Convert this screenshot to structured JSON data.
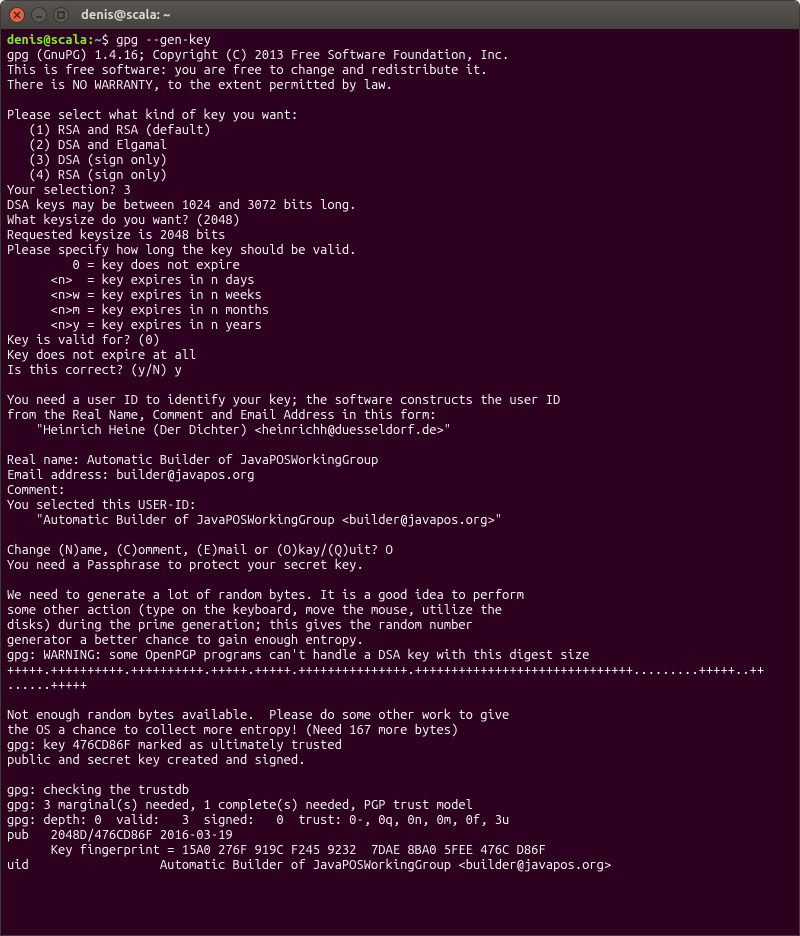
{
  "window": {
    "title": "denis@scala: ~",
    "close_icon": "close",
    "minimize_icon": "minimize",
    "maximize_icon": "maximize"
  },
  "prompt": {
    "userhost": "denis@scala",
    "path": "~",
    "command": "gpg --gen-key"
  },
  "lines": {
    "l1": "gpg (GnuPG) 1.4.16; Copyright (C) 2013 Free Software Foundation, Inc.",
    "l2": "This is free software: you are free to change and redistribute it.",
    "l3": "There is NO WARRANTY, to the extent permitted by law.",
    "l5": "Please select what kind of key you want:",
    "l6": "   (1) RSA and RSA (default)",
    "l7": "   (2) DSA and Elgamal",
    "l8": "   (3) DSA (sign only)",
    "l9": "   (4) RSA (sign only)",
    "l10": "Your selection? 3",
    "l11": "DSA keys may be between 1024 and 3072 bits long.",
    "l12": "What keysize do you want? (2048)",
    "l13": "Requested keysize is 2048 bits",
    "l14": "Please specify how long the key should be valid.",
    "l15": "         0 = key does not expire",
    "l16": "      <n>  = key expires in n days",
    "l17": "      <n>w = key expires in n weeks",
    "l18": "      <n>m = key expires in n months",
    "l19": "      <n>y = key expires in n years",
    "l20": "Key is valid for? (0)",
    "l21": "Key does not expire at all",
    "l22": "Is this correct? (y/N) y",
    "l24": "You need a user ID to identify your key; the software constructs the user ID",
    "l25": "from the Real Name, Comment and Email Address in this form:",
    "l26": "    \"Heinrich Heine (Der Dichter) <heinrichh@duesseldorf.de>\"",
    "l28": "Real name: Automatic Builder of JavaPOSWorkingGroup",
    "l29": "Email address: builder@javapos.org",
    "l30": "Comment:",
    "l31": "You selected this USER-ID:",
    "l32": "    \"Automatic Builder of JavaPOSWorkingGroup <builder@javapos.org>\"",
    "l34": "Change (N)ame, (C)omment, (E)mail or (O)kay/(Q)uit? O",
    "l35": "You need a Passphrase to protect your secret key.",
    "l37": "We need to generate a lot of random bytes. It is a good idea to perform",
    "l38": "some other action (type on the keyboard, move the mouse, utilize the",
    "l39": "disks) during the prime generation; this gives the random number",
    "l40": "generator a better chance to gain enough entropy.",
    "l41": "gpg: WARNING: some OpenPGP programs can't handle a DSA key with this digest size",
    "l42": "+++++.++++++++++.++++++++++.+++++.+++++.+++++++++++++++.++++++++++++++++++++++++++++++.........+++++..++",
    "l43": "......+++++",
    "l45": "Not enough random bytes available.  Please do some other work to give",
    "l46": "the OS a chance to collect more entropy! (Need 167 more bytes)",
    "l47": "gpg: key 476CD86F marked as ultimately trusted",
    "l48": "public and secret key created and signed.",
    "l50": "gpg: checking the trustdb",
    "l51": "gpg: 3 marginal(s) needed, 1 complete(s) needed, PGP trust model",
    "l52": "gpg: depth: 0  valid:   3  signed:   0  trust: 0-, 0q, 0n, 0m, 0f, 3u",
    "l53": "pub   2048D/476CD86F 2016-03-19",
    "l54": "      Key fingerprint = 15A0 276F 919C F245 9232  7DAE 8BA0 5FEE 476C D86F",
    "l55": "uid                  Automatic Builder of JavaPOSWorkingGroup <builder@javapos.org>"
  }
}
